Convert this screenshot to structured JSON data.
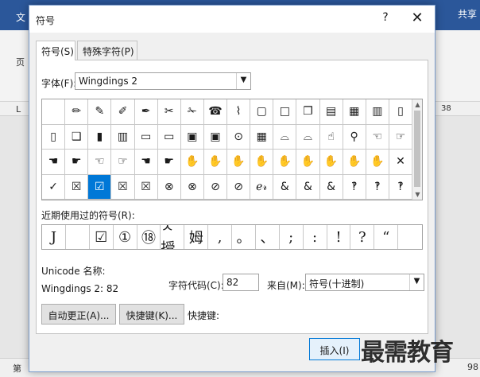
{
  "background": {
    "ribbon_tab": "文",
    "share_label": "共享",
    "page_label": "页",
    "ruler_marker": "L",
    "ruler_number": "38",
    "status_left": "第",
    "status_right": "98"
  },
  "dialog": {
    "title": "符号",
    "help_icon": "?",
    "close_icon": "✕",
    "tabs": [
      {
        "label": "符号(S)"
      },
      {
        "label": "特殊字符(P)"
      }
    ],
    "font_label": "字体(F):",
    "font_value": "Wingdings 2",
    "symbol_grid": [
      "",
      "✏",
      "✎",
      "✐",
      "✒",
      "✂",
      "✁",
      "☎",
      "⌇",
      "▢",
      "□",
      "❐",
      "▤",
      "▦",
      "▥",
      "▯",
      "▯",
      "❑",
      "▮",
      "▥",
      "▭",
      "▭",
      "▣",
      "▣",
      "⊙",
      "▦",
      "⌓",
      "⌓",
      "☝",
      "⚲",
      "☜",
      "☞",
      "☚",
      "☛",
      "☜",
      "☞",
      "☚",
      "☛",
      "✋",
      "✋",
      "✋",
      "✋",
      "✋",
      "✋",
      "✋",
      "✋",
      "✋",
      "✕",
      "✓",
      "☒",
      "☑",
      "☒",
      "☒",
      "⊗",
      "⊗",
      "⊘",
      "⊘",
      "ℯ𝓇",
      "&",
      "&",
      "&",
      "‽",
      "‽",
      "‽"
    ],
    "selected_index": 50,
    "recent_label": "近期使用过的符号(R):",
    "recent_symbols": [
      "J",
      "",
      "☑",
      "①",
      "⑱",
      "ㅅ授",
      "姆",
      ",",
      "。",
      "、",
      ";",
      ":",
      "!",
      "?",
      "“"
    ],
    "unicode_name_label": "Unicode 名称:",
    "unicode_name_value": "Wingdings 2: 82",
    "char_code_label": "字符代码(C):",
    "char_code_value": "82",
    "from_label": "来自(M):",
    "from_value": "符号(十进制)",
    "autocorrect_button": "自动更正(A)...",
    "shortcut_button": "快捷键(K)...",
    "shortcut_key_label": "快捷键:",
    "insert_button": "插入(I)"
  },
  "watermark": "最需教育"
}
